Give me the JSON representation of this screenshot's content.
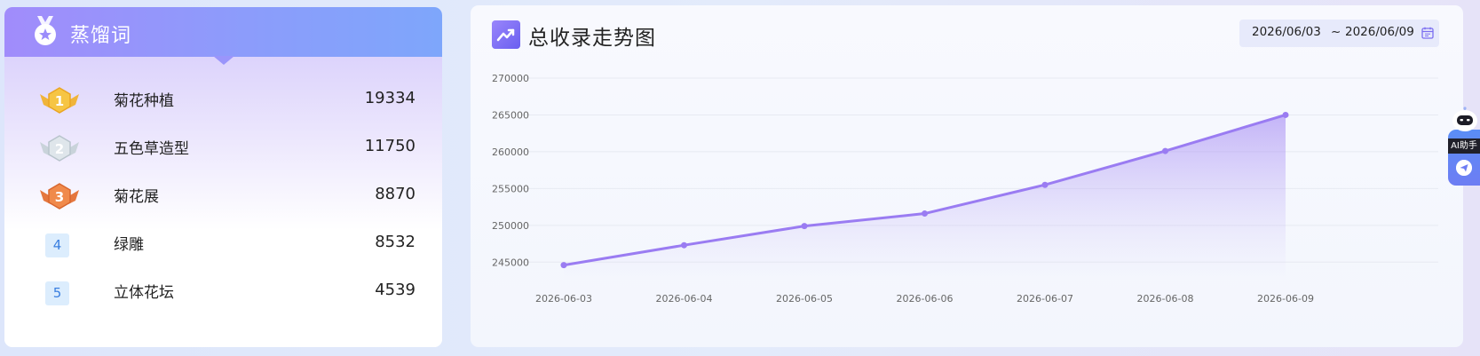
{
  "ranking": {
    "title": "蒸馏词",
    "items": [
      {
        "rank": "1",
        "name": "菊花种植",
        "value": "19334",
        "medal": "gold"
      },
      {
        "rank": "2",
        "name": "五色草造型",
        "value": "11750",
        "medal": "silver"
      },
      {
        "rank": "3",
        "name": "菊花展",
        "value": "8870",
        "medal": "bronze"
      },
      {
        "rank": "4",
        "name": "绿雕",
        "value": "8532",
        "medal": "none"
      },
      {
        "rank": "5",
        "name": "立体花坛",
        "value": "4539",
        "medal": "none"
      }
    ]
  },
  "trend": {
    "title": "总收录走势图",
    "date_start": "2026/06/03",
    "date_separator": "~",
    "date_end": "2026/06/09"
  },
  "ai_assistant": {
    "label": "AI助手"
  },
  "colors": {
    "accent": "#8f74f2",
    "header_start": "#a18cfb",
    "header_end": "#7ea6fb",
    "rank_number": "#3a7fe0"
  },
  "chart_data": {
    "type": "area",
    "title": "",
    "xlabel": "",
    "ylabel": "",
    "x": [
      "2026-06-03",
      "2026-06-04",
      "2026-06-05",
      "2026-06-06",
      "2026-06-07",
      "2026-06-08",
      "2026-06-09"
    ],
    "values": [
      244600,
      247300,
      249900,
      251600,
      255500,
      260100,
      265000
    ],
    "yticks": [
      245000,
      250000,
      255000,
      260000,
      265000,
      270000
    ],
    "ylim": [
      242500,
      270000
    ],
    "grid": true,
    "legend": "none",
    "line_color": "#9a7cf2"
  }
}
